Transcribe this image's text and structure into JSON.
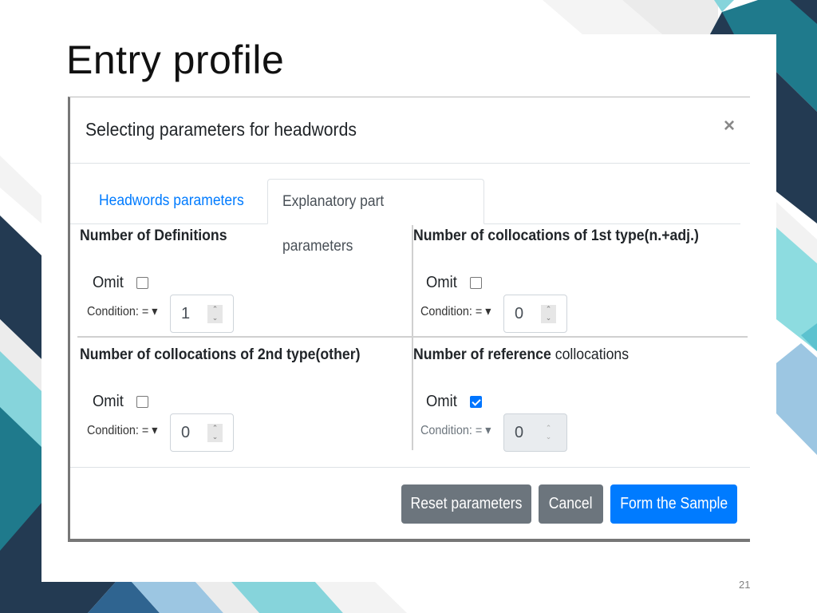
{
  "slide": {
    "title": "Entry profile",
    "page_number": "21",
    "colors": {
      "navy": "#233a52",
      "teal": "#1f7a8c",
      "light_teal": "#86d4db",
      "light_blue": "#9cc6e2",
      "mid_blue": "#2f6490",
      "light_gray": "#efefef"
    }
  },
  "modal": {
    "title": "Selecting parameters for headwords",
    "close_icon": "×",
    "tabs": [
      {
        "label": "Headwords parameters",
        "active": false
      },
      {
        "label": "Explanatory part parameters",
        "active": true
      }
    ],
    "sections": [
      {
        "title_bold": "Number of Definitions",
        "title_rest": "",
        "omit_label": "Omit",
        "omit_checked": false,
        "condition_label": "Condition: =",
        "dropdown_icon": "▾",
        "value": "1",
        "disabled": false
      },
      {
        "title_bold": "Number of collocations of 1st type(n.+adj.)",
        "title_rest": "",
        "omit_label": "Omit",
        "omit_checked": false,
        "condition_label": "Condition: =",
        "dropdown_icon": "▾",
        "value": "0",
        "disabled": false
      },
      {
        "title_bold": "Number of collocations of 2nd type(other)",
        "title_rest": "",
        "omit_label": "Omit",
        "omit_checked": false,
        "condition_label": "Condition: =",
        "dropdown_icon": "▾",
        "value": "0",
        "disabled": false
      },
      {
        "title_bold": "Number of reference",
        "title_rest": " collocations",
        "omit_label": "Omit",
        "omit_checked": true,
        "condition_label": "Condition: =",
        "dropdown_icon": "▾",
        "value": "0",
        "disabled": true
      }
    ],
    "spinner_up": "⌃",
    "spinner_down": "⌄",
    "buttons": {
      "reset": "Reset parameters",
      "cancel": "Cancel",
      "submit": "Form the Sample"
    },
    "colors": {
      "primary": "#007bff",
      "secondary": "#6c757d",
      "checkbox_checked": "#0075ff"
    }
  }
}
